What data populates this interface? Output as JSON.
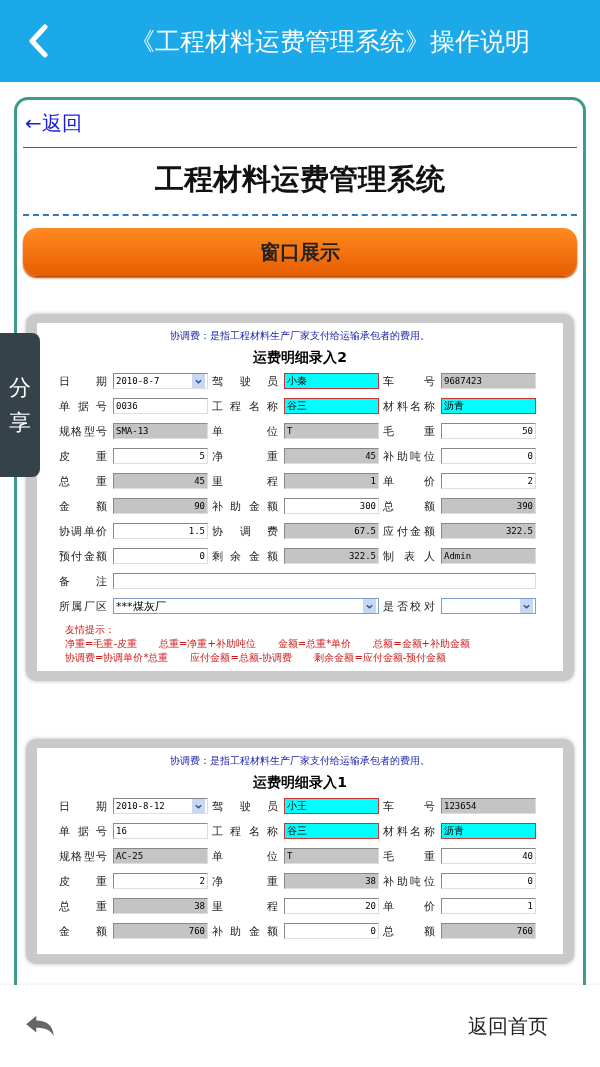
{
  "top_bar": {
    "title": "《工程材料运费管理系统》操作说明"
  },
  "back_link": "←返回",
  "heading": "工程材料运费管理系统",
  "section_button": "窗口展示",
  "share_tab": "分享",
  "forms": [
    {
      "note": "协调费：是指工程材料生产厂家支付给运输承包者的费用。",
      "title": "运费明细录入2",
      "rows": [
        [
          {
            "label": "日期",
            "value": "2010-8-7",
            "kind": "date"
          },
          {
            "label": "驾驶员",
            "value": "小秦",
            "kind": "required"
          },
          {
            "label": "车号",
            "value": "9687423",
            "kind": "readonly"
          }
        ],
        [
          {
            "label": "单据号",
            "value": "0036",
            "kind": "input"
          },
          {
            "label": "工程名称",
            "value": "谷三",
            "kind": "required"
          },
          {
            "label": "材料名称",
            "value": "沥青",
            "kind": "required"
          }
        ],
        [
          {
            "label": "规格型号",
            "value": "SMA-13",
            "kind": "readonly"
          },
          {
            "label": "单位",
            "value": "T",
            "kind": "readonly"
          },
          {
            "label": "毛重",
            "value": "50",
            "kind": "input",
            "numeric": true
          }
        ],
        [
          {
            "label": "皮重",
            "value": "5",
            "kind": "input",
            "numeric": true
          },
          {
            "label": "净重",
            "value": "45",
            "kind": "readonly",
            "numeric": true
          },
          {
            "label": "补助吨位",
            "value": "0",
            "kind": "input",
            "numeric": true
          }
        ],
        [
          {
            "label": "总重",
            "value": "45",
            "kind": "readonly",
            "numeric": true
          },
          {
            "label": "里程",
            "value": "1",
            "kind": "readonly",
            "numeric": true
          },
          {
            "label": "单价",
            "value": "2",
            "kind": "input",
            "numeric": true
          }
        ],
        [
          {
            "label": "金额",
            "value": "90",
            "kind": "readonly",
            "numeric": true
          },
          {
            "label": "补助金额",
            "value": "300",
            "kind": "input",
            "numeric": true
          },
          {
            "label": "总额",
            "value": "390",
            "kind": "readonly",
            "numeric": true
          }
        ],
        [
          {
            "label": "协调单价",
            "value": "1.5",
            "kind": "input",
            "numeric": true
          },
          {
            "label": "协调费",
            "value": "67.5",
            "kind": "readonly",
            "numeric": true
          },
          {
            "label": "应付金额",
            "value": "322.5",
            "kind": "readonly",
            "numeric": true
          }
        ],
        [
          {
            "label": "预付金额",
            "value": "0",
            "kind": "input",
            "numeric": true
          },
          {
            "label": "剩余金额",
            "value": "322.5",
            "kind": "readonly",
            "numeric": true
          },
          {
            "label": "制表人",
            "value": "Admin",
            "kind": "readonly"
          }
        ],
        [
          {
            "label": "备注",
            "kind": "memo"
          }
        ],
        [
          {
            "label": "所属厂区",
            "value": "***煤灰厂",
            "kind": "wide-select"
          },
          {
            "kind": "spacer"
          },
          {
            "label": "是否校对",
            "kind": "select"
          }
        ]
      ],
      "hint_title": "友情提示：",
      "hints": [
        [
          "净重=毛重-皮重",
          "总重=净重+补助吨位",
          "金额=总重*单价",
          "总额=金额+补助金额"
        ],
        [
          "协调费=协调单价*总重",
          "应付金额=总额-协调费",
          "剩余金额=应付金额-预付金额"
        ]
      ]
    },
    {
      "note": "协调费：是指工程材料生产厂家支付给运输承包者的费用。",
      "title": "运费明细录入1",
      "rows": [
        [
          {
            "label": "日期",
            "value": "2010-8-12",
            "kind": "date"
          },
          {
            "label": "驾驶员",
            "value": "小王",
            "kind": "required"
          },
          {
            "label": "车号",
            "value": "123654",
            "kind": "readonly"
          }
        ],
        [
          {
            "label": "单据号",
            "value": "16",
            "kind": "input"
          },
          {
            "label": "工程名称",
            "value": "谷三",
            "kind": "required"
          },
          {
            "label": "材料名称",
            "value": "沥青",
            "kind": "required"
          }
        ],
        [
          {
            "label": "规格型号",
            "value": "AC-25",
            "kind": "readonly"
          },
          {
            "label": "单位",
            "value": "T",
            "kind": "readonly"
          },
          {
            "label": "毛重",
            "value": "40",
            "kind": "input",
            "numeric": true
          }
        ],
        [
          {
            "label": "皮重",
            "value": "2",
            "kind": "input",
            "numeric": true
          },
          {
            "label": "净重",
            "value": "38",
            "kind": "readonly",
            "numeric": true
          },
          {
            "label": "补助吨位",
            "value": "0",
            "kind": "input",
            "numeric": true
          }
        ],
        [
          {
            "label": "总重",
            "value": "38",
            "kind": "readonly",
            "numeric": true
          },
          {
            "label": "里程",
            "value": "20",
            "kind": "input",
            "numeric": true
          },
          {
            "label": "单价",
            "value": "1",
            "kind": "input",
            "numeric": true
          }
        ],
        [
          {
            "label": "金额",
            "value": "760",
            "kind": "readonly",
            "numeric": true
          },
          {
            "label": "补助金额",
            "value": "0",
            "kind": "input",
            "numeric": true
          },
          {
            "label": "总额",
            "value": "760",
            "kind": "readonly",
            "numeric": true
          }
        ]
      ]
    }
  ],
  "bottom_bar": {
    "home_link": "返回首页"
  }
}
